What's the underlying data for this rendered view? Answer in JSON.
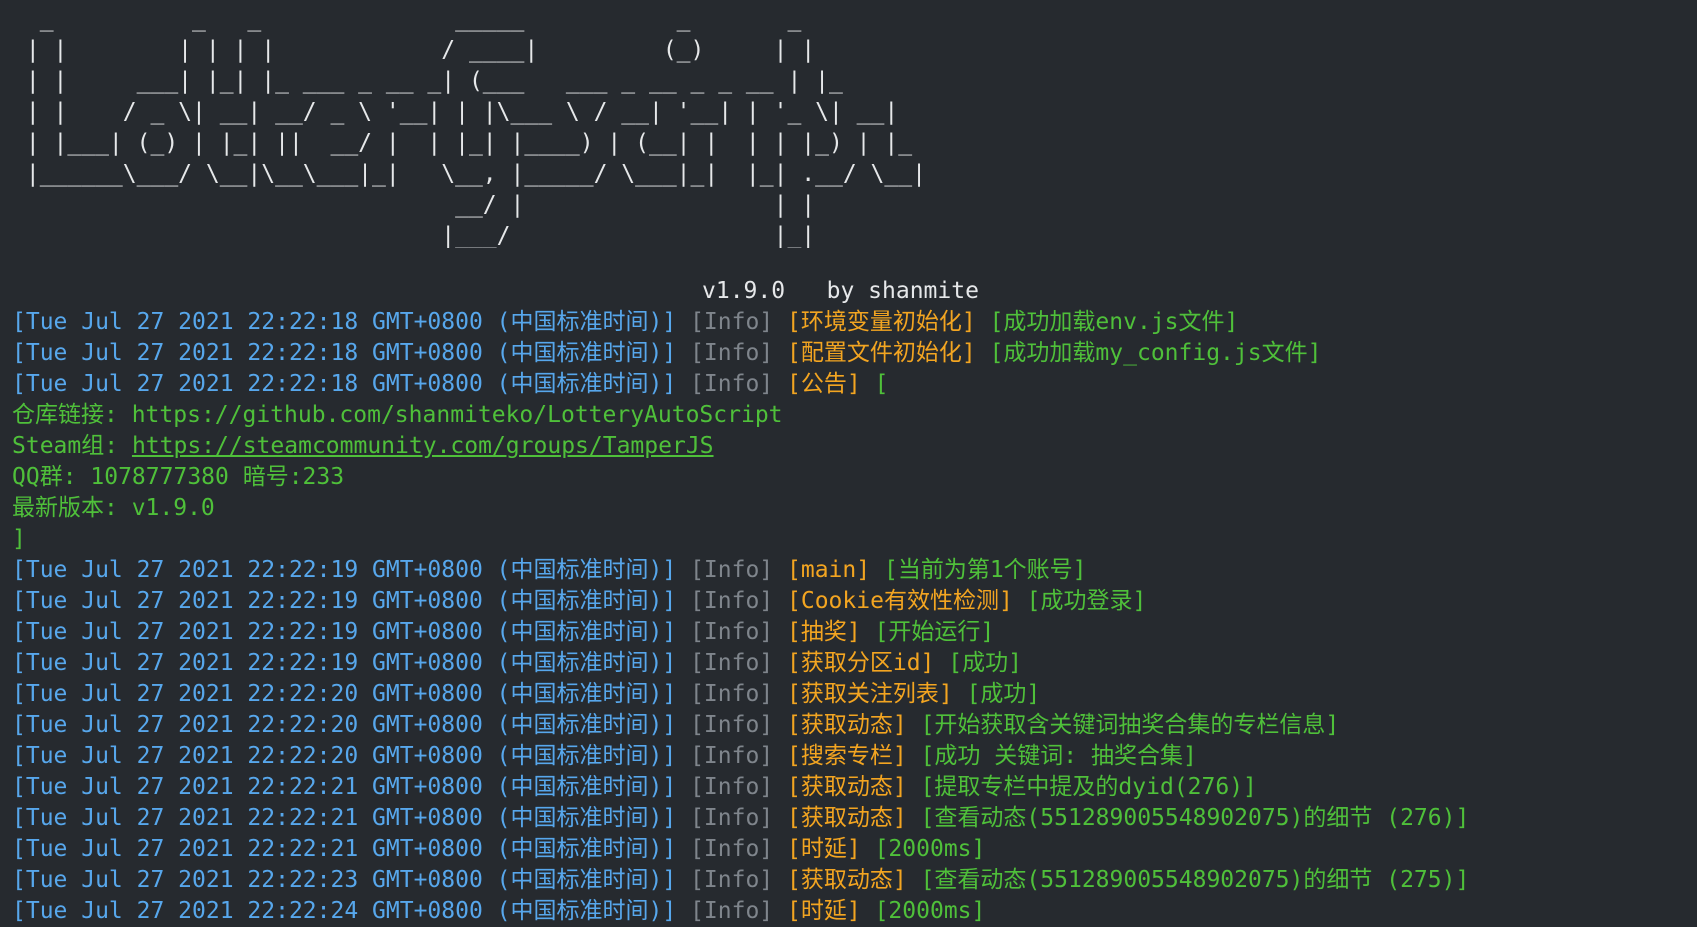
{
  "banner": {
    "ascii_art": "  _          _   _              _____           _       _   \n | |        | | | |            / ____|         (_)     | |  \n | |     ___| |_| |_ ___ _ __ _| (___   ___ _ __ _ _ __ | |_ \n | |    / _ \\| __| __/ _ \\ '__| | |\\___ \\ / __| '__| | '_ \\| __|\n | |___| (_) | |_| ||  __/ |  | |_| |____) | (__| |  | | |_) | |_ \n |______\\___/ \\__|\\__\\___|_|   \\__, |_____/ \\___|_|  |_| .__/ \\__|\n                                __/ |                  | |      \n                               |___/                   |_|      ",
    "version": "v1.9.0   by shanmite"
  },
  "log": [
    {
      "ts": "[Tue Jul 27 2021 22:22:18 GMT+0800 (中国标准时间)]",
      "level": "[Info]",
      "tag": "[环境变量初始化]",
      "msg": "[成功加载env.js文件]"
    },
    {
      "ts": "[Tue Jul 27 2021 22:22:18 GMT+0800 (中国标准时间)]",
      "level": "[Info]",
      "tag": "[配置文件初始化]",
      "msg": "[成功加载my_config.js文件]"
    },
    {
      "ts": "[Tue Jul 27 2021 22:22:18 GMT+0800 (中国标准时间)]",
      "level": "[Info]",
      "tag": "[公告]",
      "msg": "["
    }
  ],
  "notice": {
    "repo_label": "仓库链接: ",
    "repo_url": "https://github.com/shanmiteko/LotteryAutoScript",
    "steam_label": "Steam组: ",
    "steam_url": "https://steamcommunity.com/groups/TamperJS",
    "qq": "QQ群: 1078777380 暗号:233",
    "latest": "最新版本: v1.9.0",
    "close": "]"
  },
  "log2": [
    {
      "ts": "[Tue Jul 27 2021 22:22:19 GMT+0800 (中国标准时间)]",
      "level": "[Info]",
      "tag": "[main]",
      "msg": "[当前为第1个账号]"
    },
    {
      "ts": "[Tue Jul 27 2021 22:22:19 GMT+0800 (中国标准时间)]",
      "level": "[Info]",
      "tag": "[Cookie有效性检测]",
      "msg": "[成功登录]"
    },
    {
      "ts": "[Tue Jul 27 2021 22:22:19 GMT+0800 (中国标准时间)]",
      "level": "[Info]",
      "tag": "[抽奖]",
      "msg": "[开始运行]"
    },
    {
      "ts": "[Tue Jul 27 2021 22:22:19 GMT+0800 (中国标准时间)]",
      "level": "[Info]",
      "tag": "[获取分区id]",
      "msg": "[成功]"
    },
    {
      "ts": "[Tue Jul 27 2021 22:22:20 GMT+0800 (中国标准时间)]",
      "level": "[Info]",
      "tag": "[获取关注列表]",
      "msg": "[成功]"
    },
    {
      "ts": "[Tue Jul 27 2021 22:22:20 GMT+0800 (中国标准时间)]",
      "level": "[Info]",
      "tag": "[获取动态]",
      "msg": "[开始获取含关键词抽奖合集的专栏信息]"
    },
    {
      "ts": "[Tue Jul 27 2021 22:22:20 GMT+0800 (中国标准时间)]",
      "level": "[Info]",
      "tag": "[搜索专栏]",
      "msg": "[成功 关键词: 抽奖合集]"
    },
    {
      "ts": "[Tue Jul 27 2021 22:22:21 GMT+0800 (中国标准时间)]",
      "level": "[Info]",
      "tag": "[获取动态]",
      "msg": "[提取专栏中提及的dyid(276)]"
    },
    {
      "ts": "[Tue Jul 27 2021 22:22:21 GMT+0800 (中国标准时间)]",
      "level": "[Info]",
      "tag": "[获取动态]",
      "msg": "[查看动态(551289005548902075)的细节 (276)]"
    },
    {
      "ts": "[Tue Jul 27 2021 22:22:21 GMT+0800 (中国标准时间)]",
      "level": "[Info]",
      "tag": "[时延]",
      "msg": "[2000ms]"
    },
    {
      "ts": "[Tue Jul 27 2021 22:22:23 GMT+0800 (中国标准时间)]",
      "level": "[Info]",
      "tag": "[获取动态]",
      "msg": "[查看动态(551289005548902075)的细节 (275)]"
    },
    {
      "ts": "[Tue Jul 27 2021 22:22:24 GMT+0800 (中国标准时间)]",
      "level": "[Info]",
      "tag": "[时延]",
      "msg": "[2000ms]"
    }
  ],
  "colors": {
    "background": "#262a2f",
    "timestamp": "#57a7ec",
    "level": "#7f858c",
    "tag": "#f3a521",
    "message": "#4fc03a",
    "banner": "#e6e8ea"
  }
}
